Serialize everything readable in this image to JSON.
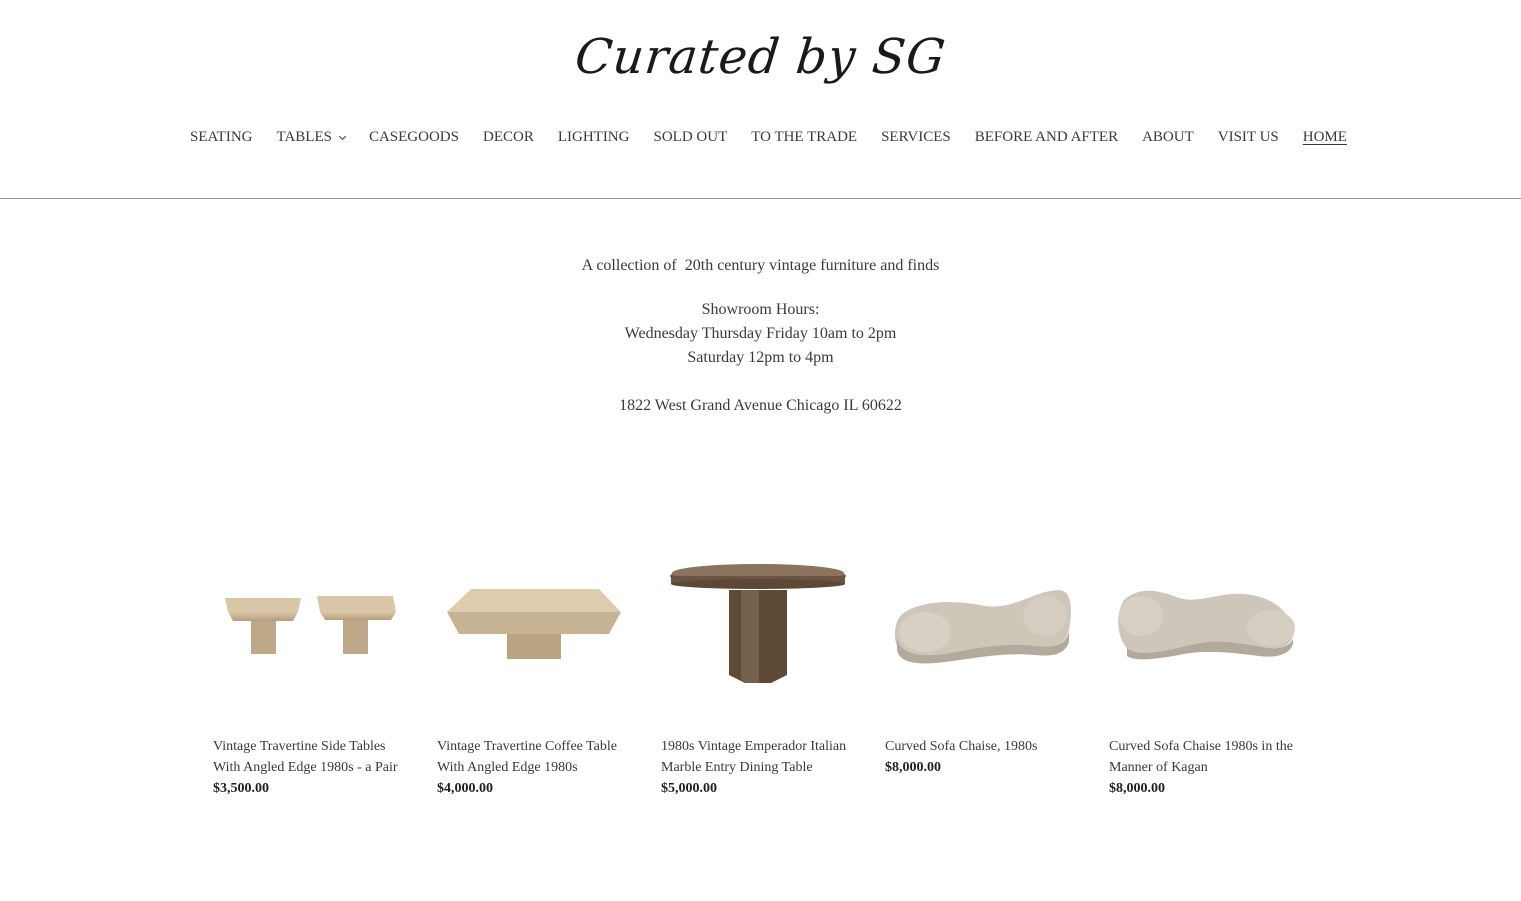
{
  "header": {
    "logo": "Curated by SG",
    "nav": [
      {
        "label": "SEATING",
        "name": "nav-seating"
      },
      {
        "label": "TABLES",
        "name": "nav-tables",
        "dropdown": true
      },
      {
        "label": "CASEGOODS",
        "name": "nav-casegoods"
      },
      {
        "label": "DECOR",
        "name": "nav-decor"
      },
      {
        "label": "LIGHTING",
        "name": "nav-lighting"
      },
      {
        "label": "SOLD OUT",
        "name": "nav-sold-out"
      },
      {
        "label": "TO THE TRADE",
        "name": "nav-to-the-trade"
      },
      {
        "label": "SERVICES",
        "name": "nav-services"
      },
      {
        "label": "BEFORE AND AFTER",
        "name": "nav-before-and-after"
      },
      {
        "label": "ABOUT",
        "name": "nav-about"
      },
      {
        "label": "VISIT US",
        "name": "nav-visit-us"
      },
      {
        "label": "HOME",
        "name": "nav-home",
        "active": true
      }
    ]
  },
  "intro": {
    "tagline": "A collection of  20th century vintage furniture and finds",
    "hours_heading": "Showroom Hours:",
    "hours_weekday": "Wednesday Thursday Friday 10am to 2pm",
    "hours_saturday": "Saturday 12pm to 4pm",
    "address": "1822 West Grand Avenue Chicago IL 60622"
  },
  "products": [
    {
      "title": "Vintage Travertine Side Tables With Angled Edge 1980s - a Pair",
      "price": "$3,500.00",
      "image_icon": "travertine-side-tables-image"
    },
    {
      "title": "Vintage Travertine Coffee Table With Angled Edge 1980s",
      "price": "$4,000.00",
      "image_icon": "travertine-coffee-table-image"
    },
    {
      "title": "1980s Vintage Emperador Italian Marble Entry Dining Table",
      "price": "$5,000.00",
      "image_icon": "marble-dining-table-image"
    },
    {
      "title": "Curved Sofa Chaise, 1980s",
      "price": "$8,000.00",
      "image_icon": "curved-sofa-chaise-image"
    },
    {
      "title": "Curved Sofa Chaise 1980s in the Manner of Kagan",
      "price": "$8,000.00",
      "image_icon": "curved-sofa-chaise-kagan-image"
    }
  ]
}
